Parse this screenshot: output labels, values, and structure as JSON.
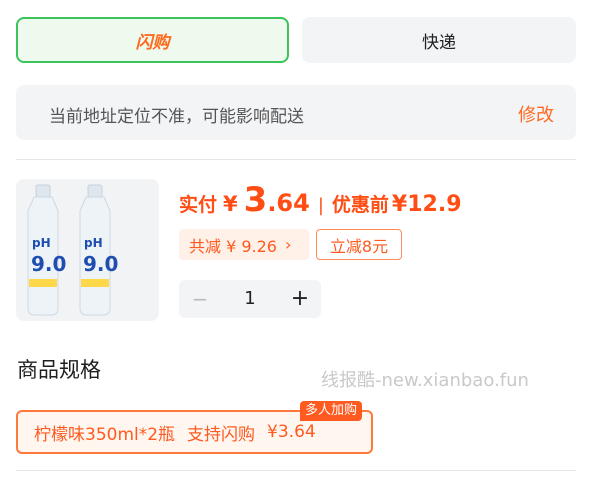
{
  "delivery": {
    "tabs": [
      {
        "label": "闪购",
        "selected": true
      },
      {
        "label": "快递",
        "selected": false
      }
    ]
  },
  "address": {
    "notice": "当前地址定位不准，可能影响配送",
    "edit_label": "修改"
  },
  "product": {
    "image_labels": [
      "pH",
      "9.0",
      "pH",
      "9.0"
    ],
    "price_label": "实付",
    "currency": "¥",
    "price_int": "3",
    "price_dec": ".64",
    "separator": "|",
    "original_label": "优惠前",
    "original_price": "¥12.9",
    "discount_text": "共减 ¥ 9.26",
    "discount_chevron": "›",
    "instant_discount": "立减8元",
    "quantity": "1",
    "minus_label": "−",
    "plus_label": "+"
  },
  "spec": {
    "title": "商品规格",
    "option_name": "柠檬味350ml*2瓶",
    "option_support": "支持闪购",
    "option_price": "¥3.64",
    "badge": "多人加购"
  },
  "watermark": "线报酷-new.xianbao.fun",
  "colors": {
    "accent_orange": "#ff5a1f",
    "selected_green": "#3cc35a",
    "panel_gray": "#f3f4f6"
  }
}
